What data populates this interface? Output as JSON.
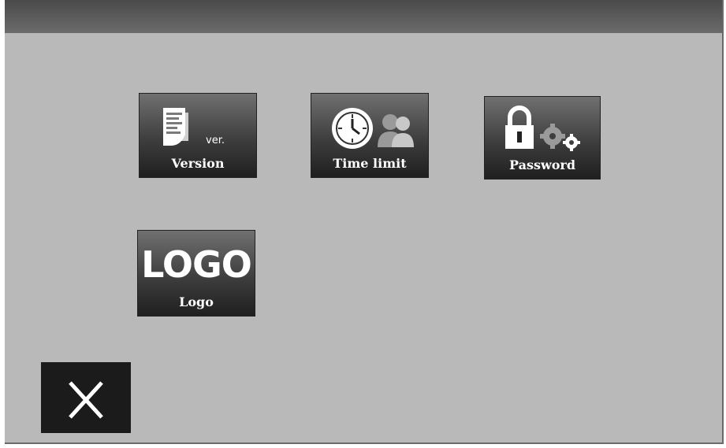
{
  "tiles": [
    {
      "label": "Version",
      "icon": "document-version-icon",
      "badge": "ver."
    },
    {
      "label": "Time limit",
      "icon": "clock-users-icon"
    },
    {
      "label": "Password",
      "icon": "lock-gears-icon"
    },
    {
      "label": "Logo",
      "icon": "logo-text-icon",
      "logo_text": "LOGO"
    }
  ],
  "close_button": {
    "icon": "close-icon"
  },
  "colors": {
    "background": "#b9b9b9",
    "tile_top": "#707070",
    "tile_bottom": "#1f1f1f",
    "close_bg": "#1b1b1b"
  }
}
